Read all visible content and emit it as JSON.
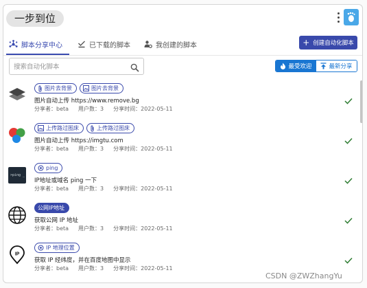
{
  "app": {
    "title": "一步到位"
  },
  "tabs": [
    {
      "label": "脚本分享中心",
      "icon": "hub-icon",
      "active": true
    },
    {
      "label": "已下载的脚本",
      "icon": "download-done-icon",
      "active": false
    },
    {
      "label": "我创建的脚本",
      "icon": "user-settings-icon",
      "active": false
    }
  ],
  "create_button": {
    "label": "创建自动化脚本"
  },
  "search": {
    "placeholder": "搜索自动化脚本",
    "value": ""
  },
  "sort": {
    "popular_label": "最受欢迎",
    "newest_label": "最新分享",
    "selected": "popular"
  },
  "colors": {
    "primary": "#3949ab",
    "accent_blue": "#1976d2",
    "check_green": "#2e7d32"
  },
  "scripts": [
    {
      "thumb": "layers-icon",
      "tags": [
        {
          "label": "图片去背景",
          "icon": "paperclip-icon",
          "filled": false
        },
        {
          "label": "图片去背景",
          "icon": "image-icon",
          "filled": false
        }
      ],
      "description": "图片自动上传 https://www.remove.bg",
      "sharer": "分享者：beta",
      "users": "用户数：3",
      "shared_at": "分享时间：2022-05-11",
      "installed": true
    },
    {
      "thumb": "color-circles-icon",
      "tags": [
        {
          "label": "上传路过图床",
          "icon": "image-icon",
          "filled": false
        },
        {
          "label": "上传路过图床",
          "icon": "paperclip-icon",
          "filled": false
        }
      ],
      "description": "图片自动上传 https://imgtu.com",
      "sharer": "分享者：beta",
      "users": "用户数：3",
      "shared_at": "分享时间：2022-05-11",
      "installed": true
    },
    {
      "thumb": "terminal-icon",
      "thumb_text": ">ping _",
      "tags": [
        {
          "label": "ping",
          "icon": "target-icon",
          "filled": false
        }
      ],
      "description": "IP地址或域名 ping 一下",
      "sharer": "分享者：beta",
      "users": "用户数：3",
      "shared_at": "分享时间：2022-05-11",
      "installed": true
    },
    {
      "thumb": "globe-icon",
      "tags": [
        {
          "label": "公网IP地址",
          "icon": "",
          "filled": true
        }
      ],
      "description": "获取公网 IP 地址",
      "sharer": "分享者：beta",
      "users": "用户数：3",
      "shared_at": "分享时间：2022-05-11",
      "installed": true
    },
    {
      "thumb": "ip-pin-icon",
      "tags": [
        {
          "label": "IP 地理位置",
          "icon": "target-icon",
          "filled": false
        }
      ],
      "description": "获取 IP 经纬度，并在百度地图中显示",
      "sharer": "分享者：beta",
      "users": "用户数：3",
      "shared_at": "分享时间：2022-05-11",
      "installed": true
    }
  ],
  "watermark": "CSDN @ZWZhangYu"
}
